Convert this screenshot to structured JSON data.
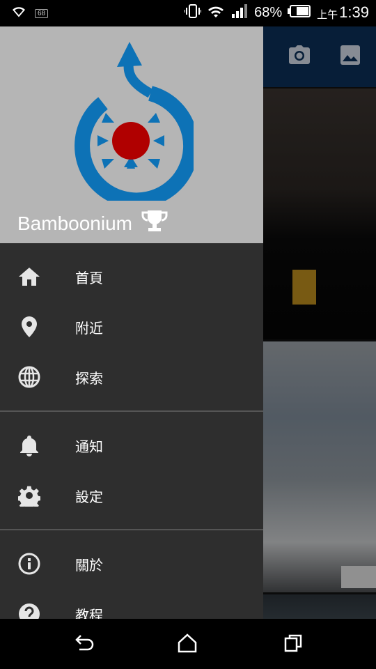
{
  "status_bar": {
    "network_badge": "68",
    "battery_percent": "68%",
    "am_pm": "上午",
    "time": "1:39"
  },
  "drawer": {
    "username": "Bamboonium",
    "items_group1": [
      {
        "label": "首頁",
        "icon": "home-icon"
      },
      {
        "label": "附近",
        "icon": "location-pin-icon"
      },
      {
        "label": "探索",
        "icon": "globe-icon"
      }
    ],
    "items_group2": [
      {
        "label": "通知",
        "icon": "bell-icon"
      },
      {
        "label": "設定",
        "icon": "gear-icon"
      }
    ],
    "items_group3": [
      {
        "label": "關於",
        "icon": "info-icon"
      },
      {
        "label": "教程",
        "icon": "help-icon"
      }
    ]
  },
  "colors": {
    "drawer_bg": "#2e2e2e",
    "header_bg": "#b5b5b5",
    "toolbar_bg": "#0b2e57",
    "logo_blue": "#0d72b6",
    "logo_red": "#b00000"
  }
}
